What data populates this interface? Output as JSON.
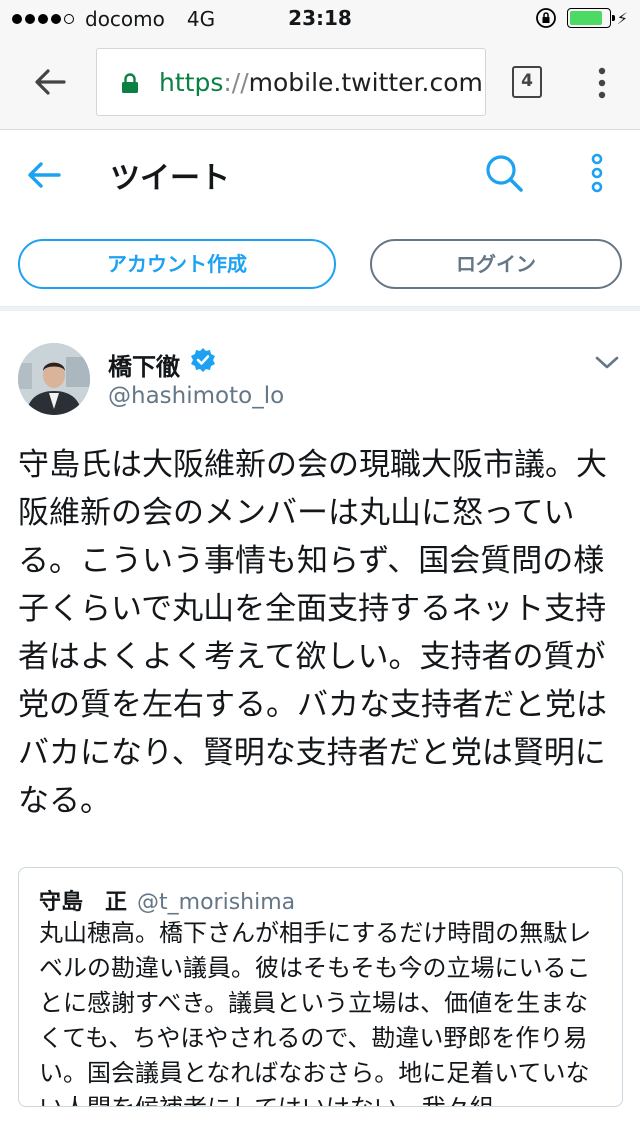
{
  "status_bar": {
    "carrier": "docomo",
    "network": "4G",
    "time": "23:18",
    "signal_bars": 4,
    "signal_total": 5,
    "battery_level": 0.85
  },
  "browser": {
    "url_scheme": "https",
    "url_sep": "://",
    "url_host": "mobile.twitter.com",
    "tab_count": "4",
    "icons": [
      "back-arrow-icon",
      "lock-icon",
      "tabs-icon",
      "more-vert-icon"
    ]
  },
  "header": {
    "title": "ツイート",
    "icons": [
      "back-arrow-icon",
      "search-icon",
      "more-vert-icon"
    ]
  },
  "actions": {
    "signup": "アカウント作成",
    "login": "ログイン"
  },
  "tweet": {
    "author_name": "橋下徹",
    "author_handle": "@hashimoto_lo",
    "text": "守島氏は大阪維新の会の現職大阪市議。大阪維新の会のメンバーは丸山に怒っている。こういう事情も知らず、国会質問の様子くらいで丸山を全面支持するネット支持者はよくよく考えて欲しい。支持者の質が党の質を左右する。バカな支持者だと党はバカになり、賢明な支持者だと党は賢明になる。"
  },
  "quote": {
    "name": "守島　正",
    "handle": "@t_morishima",
    "text": "丸山穂高。橋下さんが相手にするだけ時間の無駄レベルの勘違い議員。彼はそもそも今の立場にいることに感謝すべき。議員という立場は、価値を生まなくても、ちやほやされるので、勘違い野郎を作り易い。国会議員となればなおさら。地に足着いていない人間を候補者にしてはいけない。我々組"
  },
  "colors": {
    "twitter_blue": "#1da1f2",
    "secondary_gray": "#657786",
    "lock_green": "#0b8043",
    "battery_green": "#4cd964"
  }
}
